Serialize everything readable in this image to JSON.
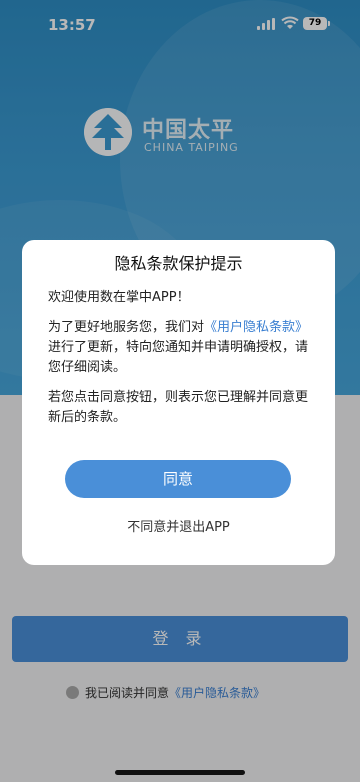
{
  "status_bar": {
    "time": "13:57",
    "battery": "79"
  },
  "brand": {
    "name_cn": "中国太平",
    "name_en": "CHINA TAIPING"
  },
  "login": {
    "button_label": "登 录",
    "agreement_prefix": "我已阅读并同意",
    "agreement_link": "《用户隐私条款》"
  },
  "dialog": {
    "title": "隐私条款保护提示",
    "greeting": "欢迎使用数在掌中APP！",
    "para1_prefix": "为了更好地服务您，我们对",
    "para1_link": "《用户隐私条款》",
    "para1_suffix": "进行了更新，特向您通知并申请明确授权，请您仔细阅读。",
    "para2": "若您点击同意按钮，则表示您已理解并同意更新后的条款。",
    "agree_label": "同意",
    "decline_label": "不同意并退出APP"
  }
}
